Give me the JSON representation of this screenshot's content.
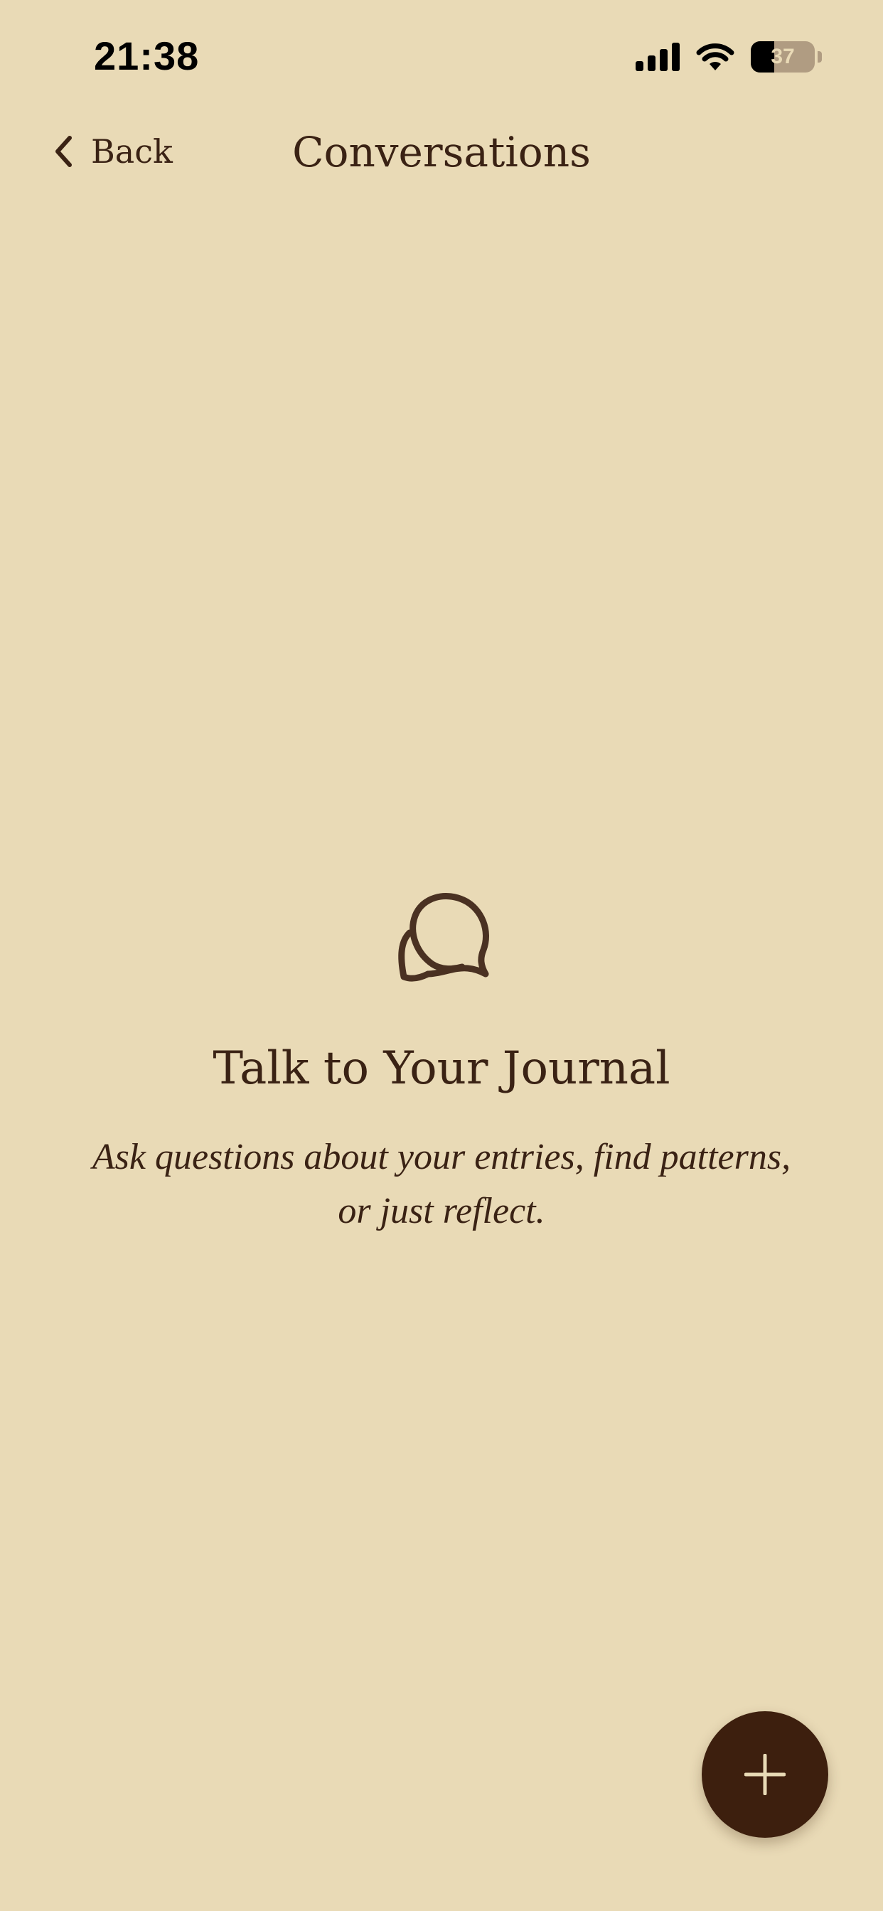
{
  "status_bar": {
    "time": "21:38",
    "battery_level": "37",
    "icons": [
      "cellular-signal-icon",
      "wifi-icon",
      "battery-icon"
    ]
  },
  "nav": {
    "back_label": "Back",
    "back_icon": "chevron-left-icon",
    "title": "Conversations"
  },
  "empty_state": {
    "icon": "chat-bubbles-icon",
    "title": "Talk to Your Journal",
    "subtitle": "Ask questions about your entries, find patterns, or just reflect."
  },
  "fab": {
    "icon": "plus-icon"
  },
  "colors": {
    "background": "#e9dab6",
    "text": "#3a2214",
    "fab": "#3d1f0e",
    "fab_icon": "#e9dab6"
  }
}
